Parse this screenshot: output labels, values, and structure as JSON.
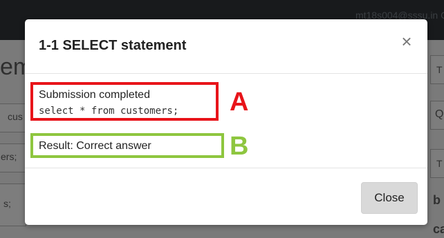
{
  "background": {
    "user_email": "mt18s004@sssu.in G",
    "heading_fragment": "em",
    "field_fragment_1": "cus",
    "field_fragment_2": "ers;",
    "field_fragment_3": "s;",
    "right_letters": [
      "T",
      "Q",
      "T"
    ],
    "right_bold_1": "b",
    "right_bold_2": "ca"
  },
  "modal": {
    "title": "1-1 SELECT statement",
    "close_icon": "×",
    "submission": {
      "status": "Submission completed",
      "query": "select * from customers;"
    },
    "result": "Result: Correct answer",
    "annotations": {
      "a": "A",
      "b": "B",
      "a_color": "#e8141a",
      "b_color": "#8ec63f"
    },
    "close_button_label": "Close"
  }
}
